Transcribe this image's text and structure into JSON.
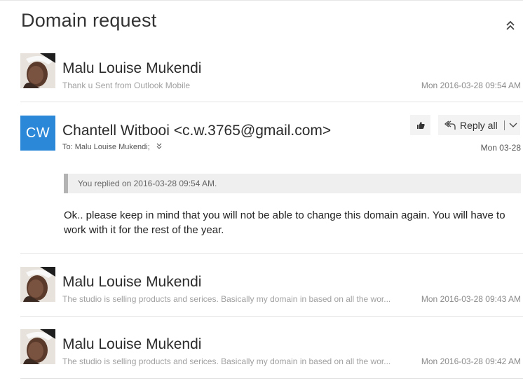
{
  "thread": {
    "title": "Domain request"
  },
  "messages": [
    {
      "sender": "Malu Louise Mukendi",
      "preview": "Thank u Sent from Outlook Mobile",
      "date": "Mon 2016-03-28 09:54 AM"
    },
    {
      "sender": "Chantell Witbooi <c.w.3765@gmail.com>",
      "initials": "CW",
      "to": "To: Malu Louise Mukendi;",
      "date": "Mon 03-28",
      "replied_notice": "You replied on 2016-03-28 09:54 AM.",
      "body": "Ok.. please keep in mind that you will not be able to change this domain again. You will have to work with it for the rest of the year.",
      "reply_all_label": "Reply all"
    },
    {
      "sender": "Malu Louise Mukendi",
      "preview": "The studio is selling products and serices. Basically my domain in based on all the wor...",
      "date": "Mon 2016-03-28 09:43 AM"
    },
    {
      "sender": "Malu Louise Mukendi",
      "preview": "The studio is selling products and serices. Basically my domain in based on all the wor...",
      "date": "Mon 2016-03-28 09:42 AM"
    }
  ],
  "colors": {
    "avatar_initials_bg": "#2b88d8",
    "button_bg": "#f3f3f3"
  },
  "icons": [
    "collapse-up-icon",
    "like-icon",
    "reply-all-icon",
    "chevron-down-icon"
  ]
}
